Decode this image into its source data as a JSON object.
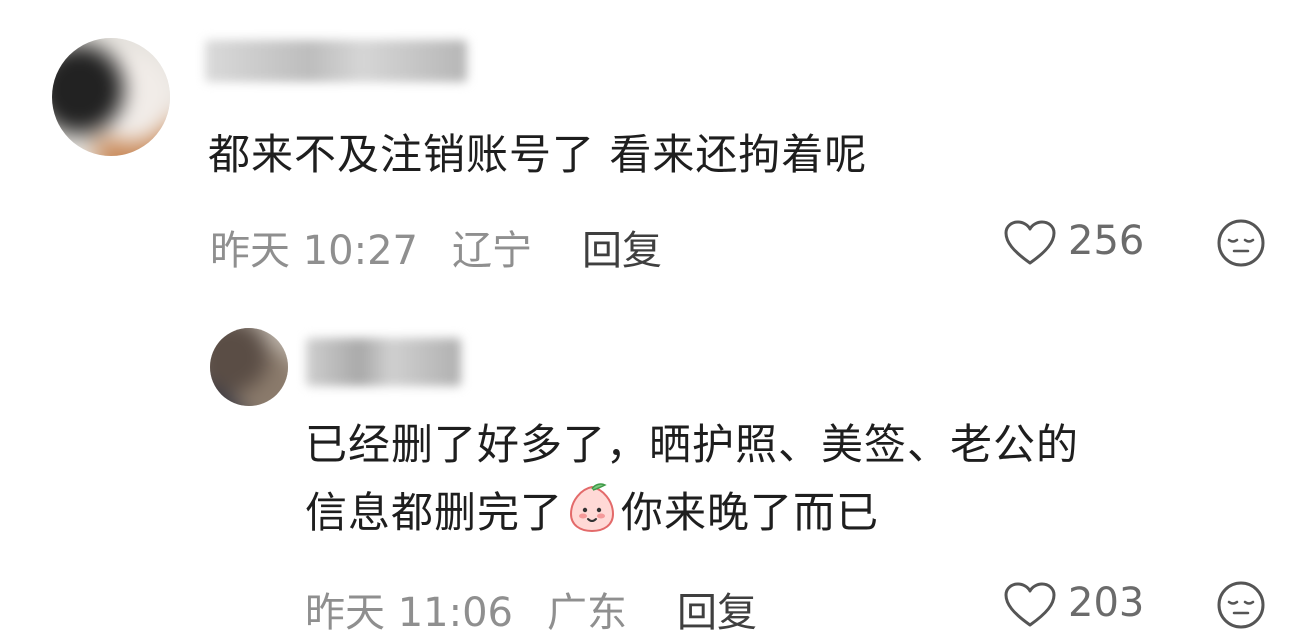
{
  "comments": [
    {
      "username": "",
      "text": "都来不及注销账号了 看来还拘着呢",
      "time": "昨天 10:27",
      "location": "辽宁",
      "reply_label": "回复",
      "likes": "256"
    },
    {
      "username": "",
      "text_line1": "已经删了好多了，晒护照、美签、老公的",
      "text_line2_a": "信息都删完了",
      "text_line2_b": "你来晚了而已",
      "emoji_icon": "smiling-peach-emoji",
      "time": "昨天 11:06",
      "location": "广东",
      "reply_label": "回复",
      "likes": "203"
    }
  ],
  "icons": {
    "like": "heart-outline-icon",
    "dislike": "neutral-face-icon"
  },
  "colors": {
    "body_text": "#1e1e1e",
    "meta_text": "#8f8f8f",
    "reply_text": "#3f3f3f",
    "icon_stroke": "#555555"
  }
}
